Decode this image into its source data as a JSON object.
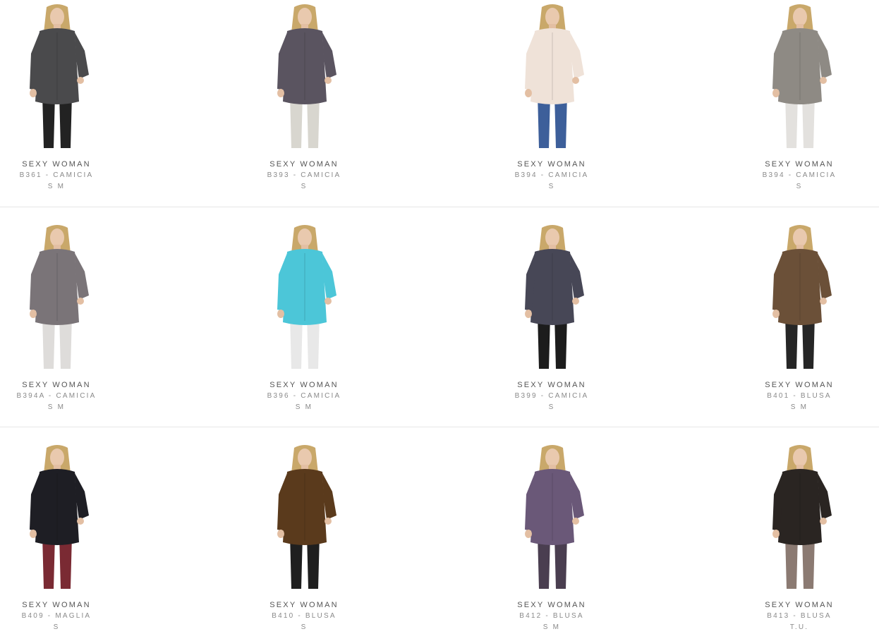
{
  "products": [
    {
      "brand": "SEXY WOMAN",
      "model": "B361 - CAMICIA",
      "sizes": "S M",
      "top": "#4a4a4c",
      "bottom": "#222222"
    },
    {
      "brand": "SEXY WOMAN",
      "model": "B393 - CAMICIA",
      "sizes": "S",
      "top": "#5a5460",
      "bottom": "#d8d6cf"
    },
    {
      "brand": "SEXY WOMAN",
      "model": "B394 - CAMICIA",
      "sizes": "S",
      "top": "#efe2d8",
      "bottom": "#3d5f9a"
    },
    {
      "brand": "SEXY WOMAN",
      "model": "B394 - CAMICIA",
      "sizes": "S",
      "top": "#8e8a84",
      "bottom": "#e3e1de"
    },
    {
      "brand": "SEXY WOMAN",
      "model": "B394A - CAMICIA",
      "sizes": "S M",
      "top": "#7a7478",
      "bottom": "#dedcda"
    },
    {
      "brand": "SEXY WOMAN",
      "model": "B396 - CAMICIA",
      "sizes": "S M",
      "top": "#4cc6d8",
      "bottom": "#e8e8e8"
    },
    {
      "brand": "SEXY WOMAN",
      "model": "B399 - CAMICIA",
      "sizes": "S",
      "top": "#474756",
      "bottom": "#1c1c1c"
    },
    {
      "brand": "SEXY WOMAN",
      "model": "B401 - BLUSA",
      "sizes": "S M",
      "top": "#6b5038",
      "bottom": "#262626"
    },
    {
      "brand": "SEXY WOMAN",
      "model": "B409 - MAGLIA",
      "sizes": "S",
      "top": "#1e1e24",
      "bottom": "#7a2a33"
    },
    {
      "brand": "SEXY WOMAN",
      "model": "B410 - BLUSA",
      "sizes": "S",
      "top": "#5a3a1c",
      "bottom": "#1f1f1f"
    },
    {
      "brand": "SEXY WOMAN",
      "model": "B412 - BLUSA",
      "sizes": "S M",
      "top": "#6a5878",
      "bottom": "#4a3e50"
    },
    {
      "brand": "SEXY WOMAN",
      "model": "B413 - BLUSA",
      "sizes": "T.U.",
      "top": "#2a2522",
      "bottom": "#8b7a72"
    }
  ]
}
